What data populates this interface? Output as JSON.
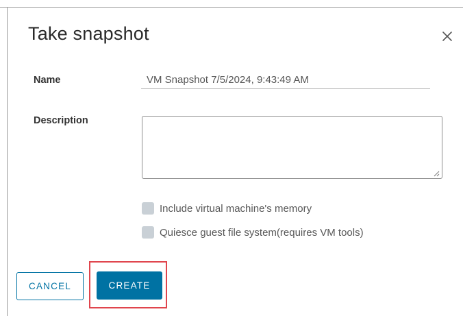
{
  "dialog": {
    "title": "Take snapshot",
    "close_icon": "close-icon"
  },
  "form": {
    "name_label": "Name",
    "name_value": "VM Snapshot 7/5/2024, 9:43:49 AM",
    "description_label": "Description",
    "description_value": "",
    "options": [
      {
        "label": "Include virtual machine's memory",
        "checked": false
      },
      {
        "label": "Quiesce guest file system(requires VM tools)",
        "checked": false
      }
    ]
  },
  "actions": {
    "cancel_label": "CANCEL",
    "create_label": "CREATE"
  },
  "colors": {
    "primary": "#0072a3",
    "highlight": "#e0454d",
    "checkbox_disabled": "#c9d0d6"
  }
}
